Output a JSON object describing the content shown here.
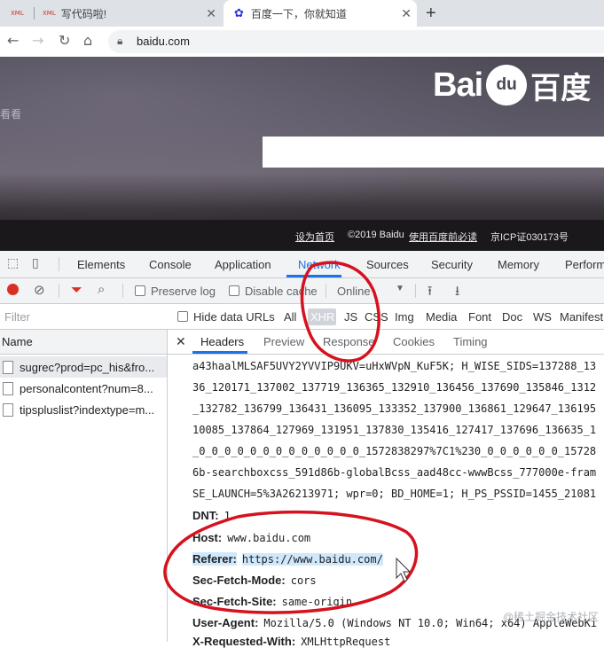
{
  "browser": {
    "tabs": [
      {
        "favicon": "XML",
        "title": ""
      },
      {
        "favicon": "XML",
        "title": "写代码啦!"
      },
      {
        "favicon": "baidu-paw-icon",
        "title": "百度一下，你就知道"
      }
    ],
    "new_tab_symbol": "+",
    "address": "baidu.com"
  },
  "page": {
    "logo_latin": "Bai",
    "logo_paw": "du",
    "logo_cn": "百度",
    "side_text": "看看",
    "footer": {
      "set_home": "设为首页",
      "copyright": "©2019 Baidu",
      "must_read": "使用百度前必读",
      "icp": "京ICP证030173号"
    }
  },
  "devtools": {
    "tabs": [
      "Elements",
      "Console",
      "Application",
      "Network",
      "Sources",
      "Security",
      "Memory",
      "Perform"
    ],
    "active_tab": "Network",
    "toolbar": {
      "preserve_log": "Preserve log",
      "disable_cache": "Disable cache",
      "throttle": "Online"
    },
    "filter": {
      "placeholder": "Filter",
      "hide_data_urls": "Hide data URLs",
      "types": [
        "All",
        "XHR",
        "JS",
        "CSS",
        "Img",
        "Media",
        "Font",
        "Doc",
        "WS",
        "Manifest"
      ],
      "selected_type": "XHR"
    },
    "name_header": "Name",
    "requests": [
      "sugrec?prod=pc_his&fro...",
      "personalcontent?num=8...",
      "tipspluslist?indextype=m..."
    ],
    "detail_tabs": [
      "Headers",
      "Preview",
      "Response",
      "Cookies",
      "Timing"
    ],
    "detail_active": "Headers",
    "cookie_lines": [
      "a43haalMLSAF5UVY2YVVIP9UKV=uHxWVpN_KuF5K; H_WISE_SIDS=137288_13",
      "36_120171_137002_137719_136365_132910_136456_137690_135846_1312",
      "_132782_136799_136431_136095_133352_137900_136861_129647_136195",
      "10085_137864_127969_131951_137830_135416_127417_137696_136635_1",
      "_0_0_0_0_0_0_0_0_0_0_0_0_0_1572838297%7C1%230_0_0_0_0_0_0_15728",
      "6b-searchboxcss_591d86b-globalBcss_aad48cc-wwwBcss_777000e-fram",
      "SE_LAUNCH=5%3A26213971; wpr=0; BD_HOME=1; H_PS_PSSID=1455_21081"
    ],
    "headers": [
      {
        "key": "DNT:",
        "value": "1"
      },
      {
        "key": "Host:",
        "value": "www.baidu.com"
      },
      {
        "key": "Referer:",
        "value": "https://www.baidu.com/"
      },
      {
        "key": "Sec-Fetch-Mode:",
        "value": "cors"
      },
      {
        "key": "Sec-Fetch-Site:",
        "value": "same-origin"
      },
      {
        "key": "User-Agent:",
        "value": "Mozilla/5.0 (Windows NT 10.0; Win64; x64) AppleWebKi"
      },
      {
        "key": "X-Requested-With:",
        "value": "XMLHttpRequest"
      }
    ]
  },
  "watermark": "@稀土掘金技术社区",
  "colors": {
    "annotation": "#d5121e",
    "selection_highlight": "#cfe8fc",
    "accent": "#1a73e8",
    "record": "#d93025"
  }
}
